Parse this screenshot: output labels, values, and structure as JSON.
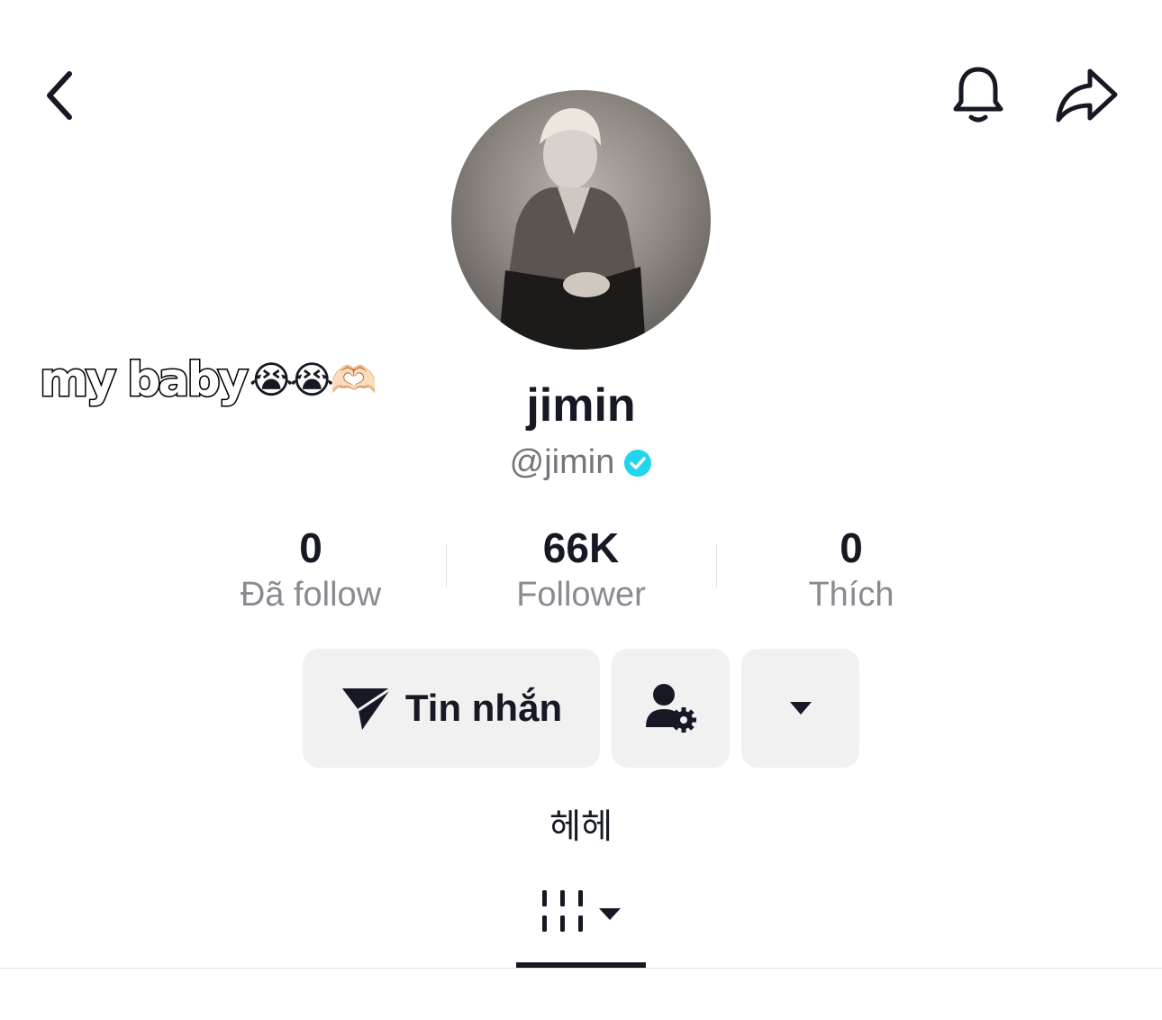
{
  "header": {
    "back_icon": "chevron-left-icon",
    "notification_icon": "bell-icon",
    "share_icon": "share-arrow-icon"
  },
  "sticker": {
    "text": "my baby",
    "emojis": "😭😭🫶🏻"
  },
  "profile": {
    "display_name": "jimin",
    "handle": "@jimin",
    "verified": true,
    "verified_color": "#20d5ec",
    "bio": "헤헤"
  },
  "stats": [
    {
      "value": "0",
      "label": "Đã follow"
    },
    {
      "value": "66K",
      "label": "Follower"
    },
    {
      "value": "0",
      "label": "Thích"
    }
  ],
  "actions": {
    "message_label": "Tin nhắn",
    "message_icon": "send-icon",
    "friend_settings_icon": "user-gear-icon",
    "more_icon": "caret-down-icon"
  },
  "tabs": {
    "active_icon": "grid-videos-icon",
    "dropdown_icon": "caret-down-icon"
  }
}
